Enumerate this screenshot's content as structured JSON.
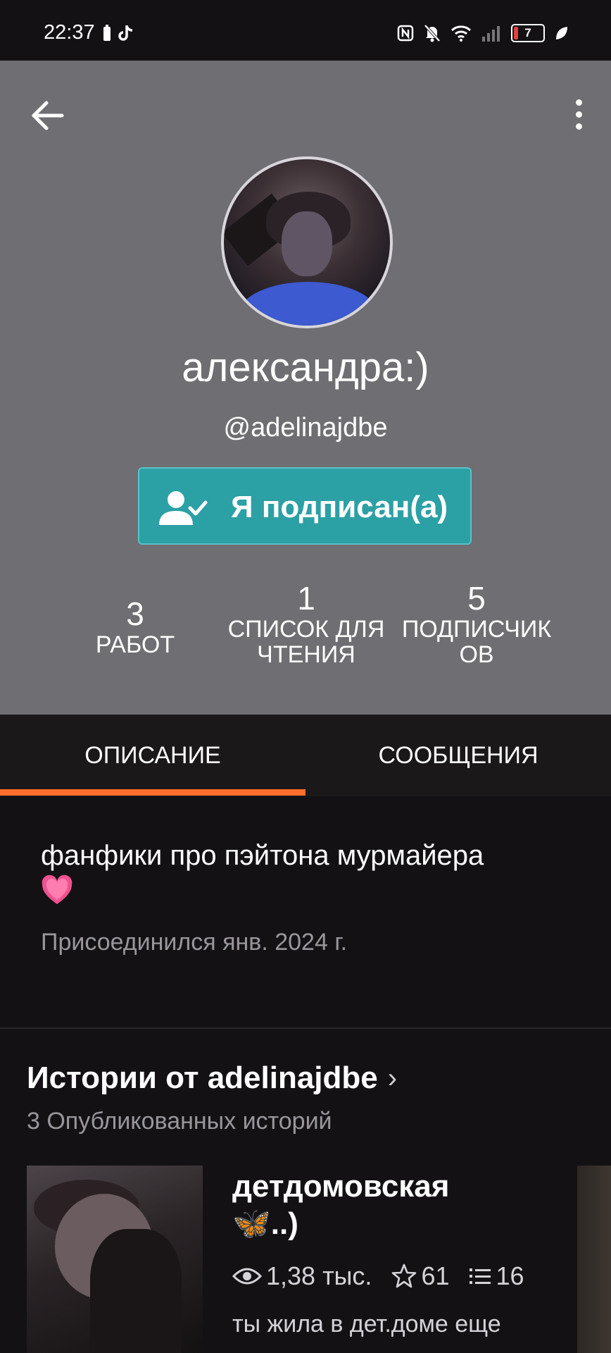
{
  "status_bar": {
    "time": "22:37",
    "battery_level": "7",
    "icons": [
      "battery-saver-icon",
      "tiktok-icon",
      "nfc-icon",
      "mute-icon",
      "wifi-icon",
      "signal-icon",
      "leaf-icon"
    ]
  },
  "profile": {
    "display_name": "александра:)",
    "username": "@adelinajdbe",
    "follow_button_label": "Я подписан(а)",
    "stats": [
      {
        "value": "3",
        "label": "РАБОТ"
      },
      {
        "value": "1",
        "label": "СПИСОК ДЛЯ ЧТЕНИЯ"
      },
      {
        "value": "5",
        "label": "ПОДПИСЧИКОВ"
      }
    ]
  },
  "tabs": [
    {
      "label": "ОПИСАНИЕ",
      "active": true
    },
    {
      "label": "СООБЩЕНИЯ",
      "active": false
    }
  ],
  "description": {
    "text": "фанфики про пэйтона мурмайера",
    "emoji": "heart",
    "joined": "Присоединился янв. 2024 г."
  },
  "stories": {
    "title": "Истории от adelinajdbe",
    "subtitle": "3 Опубликованных историй",
    "items": [
      {
        "title": "детдомовская 🦋..)",
        "reads": "1,38 тыс.",
        "votes": "61",
        "parts": "16",
        "excerpt": "ты жила в дет.доме еще"
      }
    ]
  },
  "colors": {
    "header_bg": "#6f6e72",
    "follow_button": "#2ba0a5",
    "tab_accent": "#ff6d2d",
    "page_bg": "#131114"
  }
}
